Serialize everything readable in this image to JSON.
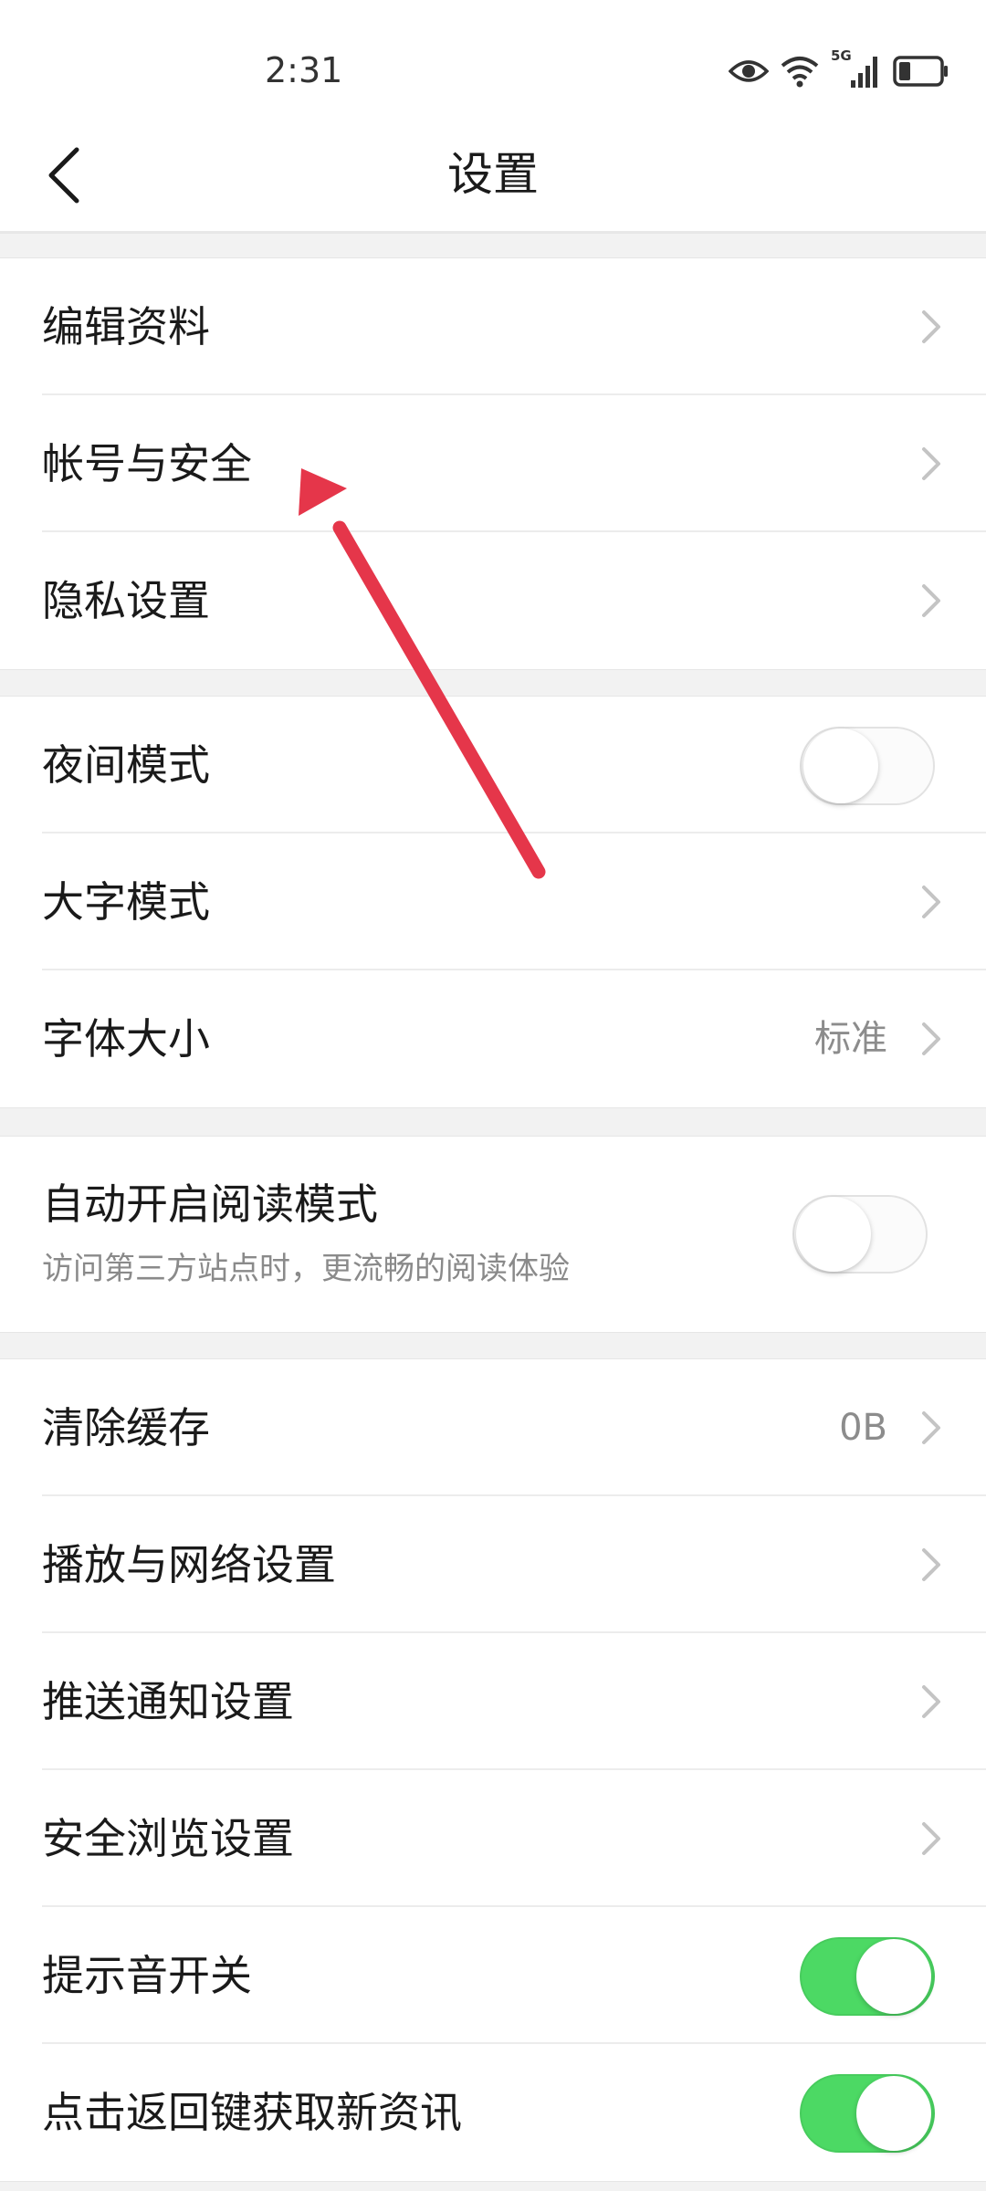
{
  "status": {
    "time": "2:31",
    "icons": [
      "eye-icon",
      "wifi-icon",
      "signal-5g-icon",
      "battery-icon"
    ],
    "network_label": "5G"
  },
  "header": {
    "title": "设置",
    "back_icon": "chevron-left-icon"
  },
  "groups": {
    "account": [
      {
        "label": "编辑资料"
      },
      {
        "label": "帐号与安全"
      },
      {
        "label": "隐私设置"
      }
    ],
    "display": {
      "night_mode": {
        "label": "夜间模式",
        "on": false
      },
      "big_text": {
        "label": "大字模式"
      },
      "font_size": {
        "label": "字体大小",
        "value": "标准"
      }
    },
    "reader": {
      "title": "自动开启阅读模式",
      "subtitle": "访问第三方站点时，更流畅的阅读体验",
      "on": false
    },
    "misc": {
      "clear_cache": {
        "label": "清除缓存",
        "value": "0B"
      },
      "playback": {
        "label": "播放与网络设置"
      },
      "push": {
        "label": "推送通知设置"
      },
      "safe_browse": {
        "label": "安全浏览设置"
      },
      "sound": {
        "label": "提示音开关",
        "on": true
      },
      "back_refresh": {
        "label": "点击返回键获取新资讯",
        "on": true
      }
    }
  },
  "colors": {
    "toggle_on": "#4cd964",
    "arrow": "#e5364a",
    "group_gap": "#f2f2f2"
  }
}
